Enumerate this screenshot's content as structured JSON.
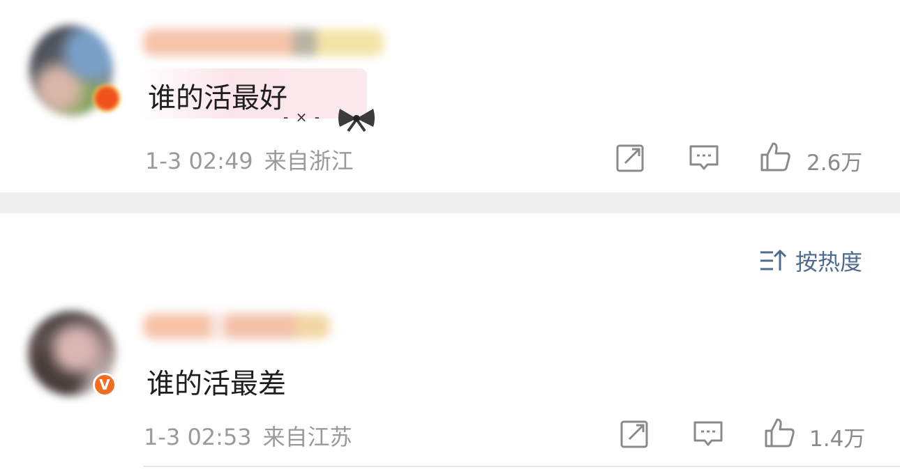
{
  "comments": [
    {
      "text": "谁的活最好",
      "time": "1-3 02:49",
      "location": "来自浙江",
      "likes": "2.6万",
      "decoration": "- × -",
      "verified": true
    },
    {
      "text": "谁的活最差",
      "time": "1-3 02:53",
      "location": "来自江苏",
      "likes": "1.4万",
      "verified": true,
      "badge_letter": "V"
    }
  ],
  "sort": {
    "label": "按热度"
  },
  "colors": {
    "meta_gray": "#9a9a9a",
    "sort_blue": "#4e6a8f",
    "separator": "#efefef",
    "verified_orange": "#f26d1f"
  },
  "icons": {
    "repost": "repost-icon",
    "reply": "comment-icon",
    "like": "thumbs-up-icon",
    "sort": "sort-icon"
  }
}
